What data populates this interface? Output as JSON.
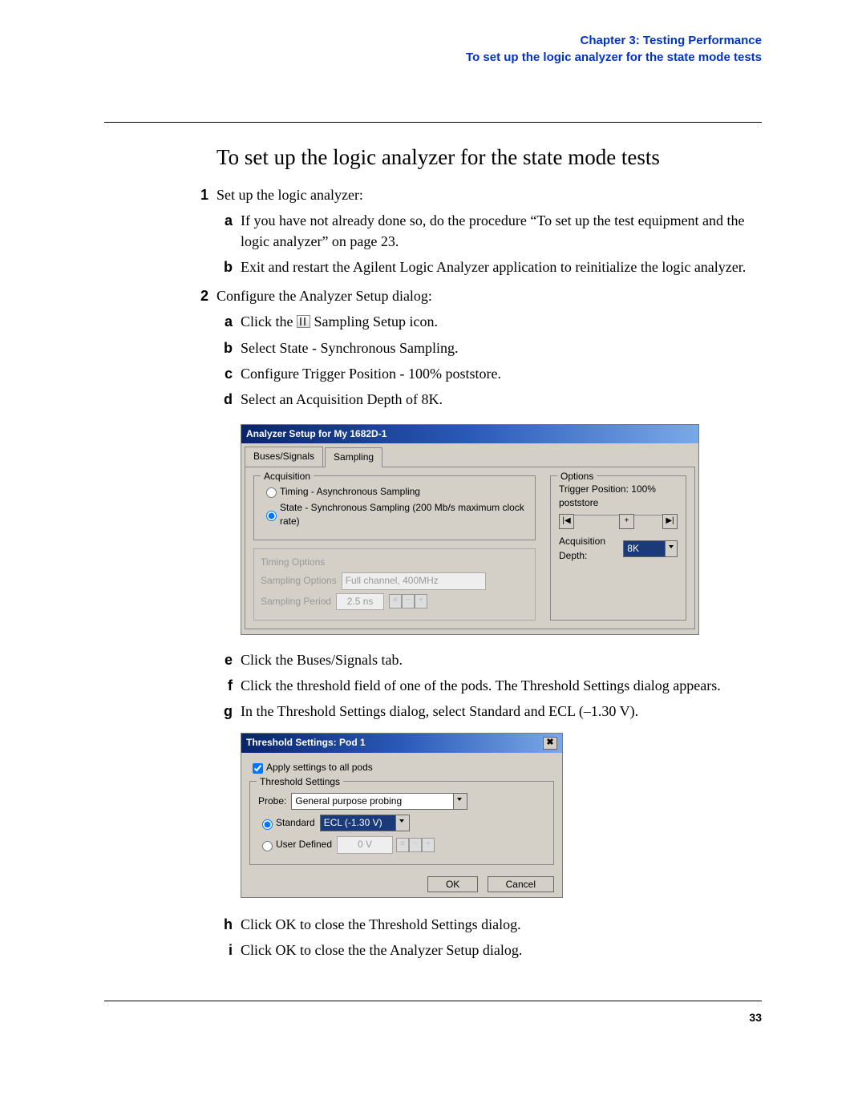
{
  "header": {
    "chapter": "Chapter 3: Testing Performance",
    "section": "To set up the logic analyzer for the state mode tests"
  },
  "title": "To set up the logic analyzer for the state mode tests",
  "steps": {
    "s1": {
      "num": "1",
      "text": "Set up the logic analyzer:",
      "a": "If you have not already done so, do the procedure “To set up the test equipment and the logic analyzer” on page 23.",
      "b": "Exit and restart the Agilent Logic Analyzer application to reinitialize the logic analyzer."
    },
    "s2": {
      "num": "2",
      "text": "Configure the Analyzer Setup dialog:",
      "a_pre": "Click the ",
      "a_post": " Sampling Setup icon.",
      "b": "Select State - Synchronous Sampling.",
      "c": "Configure Trigger Position - 100% poststore.",
      "d": "Select an Acquisition Depth of 8K.",
      "e": "Click the Buses/Signals tab.",
      "f": "Click the threshold field of one of the pods. The Threshold Settings dialog appears.",
      "g": "In the Threshold Settings dialog, select Standard and ECL (–1.30 V).",
      "h": "Click OK to close the Threshold Settings dialog.",
      "i": "Click OK to close the the Analyzer Setup dialog."
    }
  },
  "dialog1": {
    "title": "Analyzer Setup for My 1682D-1",
    "tabs": {
      "buses": "Buses/Signals",
      "sampling": "Sampling"
    },
    "acq_title": "Acquisition",
    "radio_timing": "Timing - Asynchronous Sampling",
    "radio_state": "State - Synchronous Sampling (200 Mb/s maximum clock rate)",
    "timing_title": "Timing Options",
    "sampling_options_label": "Sampling Options",
    "sampling_options_value": "Full channel, 400MHz",
    "sampling_period_label": "Sampling Period",
    "sampling_period_value": "2.5 ns",
    "options_title": "Options",
    "trigger_position": "Trigger Position: 100% poststore",
    "slider_l": "|◀",
    "slider_m": "+",
    "slider_r": "▶|",
    "acq_depth_label": "Acquisition Depth:",
    "acq_depth_value": "8K"
  },
  "dialog2": {
    "title": "Threshold Settings: Pod 1",
    "close": "✖",
    "apply_all": "Apply settings to all pods",
    "group_title": "Threshold Settings",
    "probe_label": "Probe:",
    "probe_value": "General purpose probing",
    "standard_label": "Standard",
    "standard_value": "ECL (-1.30 V)",
    "userdef_label": "User Defined",
    "userdef_value": "0 V",
    "ok": "OK",
    "cancel": "Cancel"
  },
  "page_number": "33"
}
